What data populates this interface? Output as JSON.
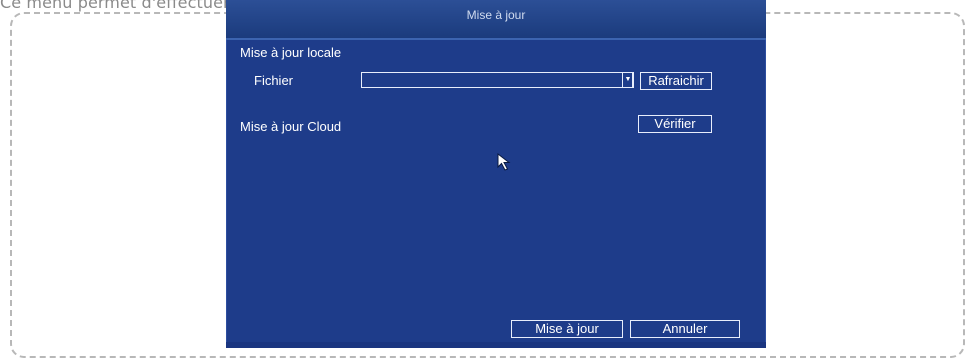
{
  "caption": "Ce menu permet d'effectuer la mise à jour du micrologiciel de votre enregistreur.",
  "dialog": {
    "title": "Mise à jour",
    "local_update": {
      "heading": "Mise à jour locale",
      "file_label": "Fichier",
      "file_value": "",
      "refresh_label": "Rafraichir"
    },
    "cloud_update": {
      "heading": "Mise à jour Cloud",
      "check_label": "Vérifier"
    },
    "footer": {
      "update_label": "Mise à jour",
      "cancel_label": "Annuler"
    }
  },
  "icons": {
    "dropdown": "chevron-down-icon",
    "cursor": "mouse-pointer-icon"
  },
  "colors": {
    "dialog_background": "#1e3c8a",
    "title_bar": "#24468a",
    "text": "#ffffff",
    "button_border": "#e8eefc",
    "caption_text": "#8a8a8a",
    "frame_border": "#b8b8b8"
  }
}
